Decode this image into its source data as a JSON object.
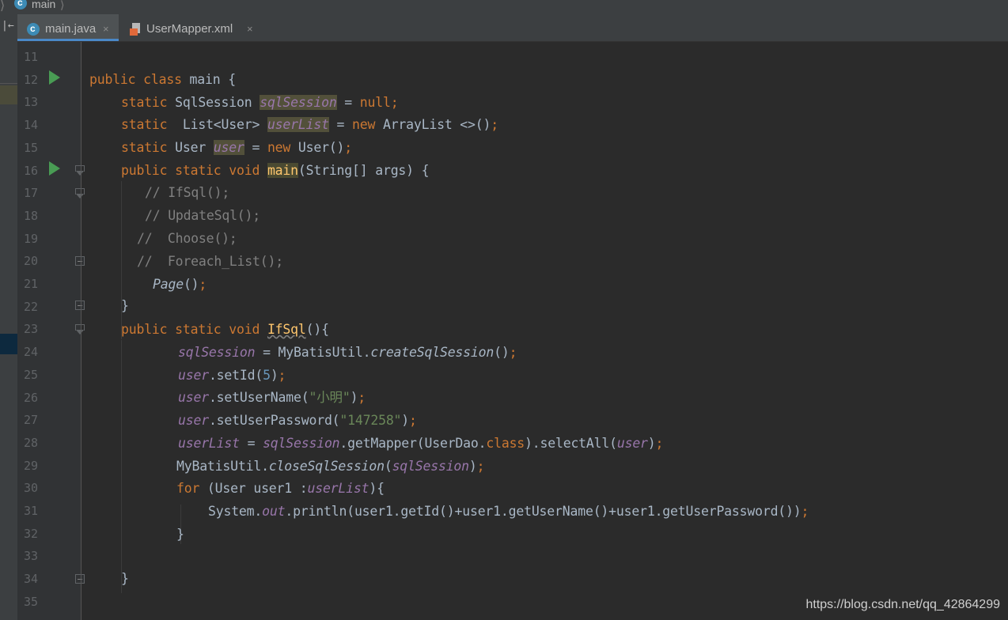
{
  "breadcrumb": {
    "item": "main"
  },
  "tabs": [
    {
      "label": "main.java",
      "active": true,
      "icon": "java-class-icon"
    },
    {
      "label": "UserMapper.xml",
      "active": false,
      "icon": "xml-file-icon"
    }
  ],
  "tab_close_glyph": "×",
  "gutter": {
    "line_numbers": [
      "11",
      "12",
      "13",
      "14",
      "15",
      "16",
      "17",
      "18",
      "19",
      "20",
      "21",
      "22",
      "23",
      "24",
      "25",
      "26",
      "27",
      "28",
      "29",
      "30",
      "31",
      "32",
      "33",
      "34",
      "35"
    ]
  },
  "code": {
    "l12": {
      "kw": "public class",
      "rest": " main {"
    },
    "l13": {
      "kw": "static",
      "type": " SqlSession ",
      "field": "sqlSession",
      "eq": " = ",
      "val": "null;"
    },
    "l14": {
      "kw": "static",
      "type": "  List<User> ",
      "field": "userList",
      "eq": " = ",
      "new": "new",
      "rest": " ArrayList <>()",
      "semi": ";"
    },
    "l15": {
      "kw": "static",
      "type": " User ",
      "field": "user",
      "eq": " = ",
      "new": "new",
      "rest": " User()",
      "semi": ";"
    },
    "l16": {
      "kw": "public static void",
      "sp": " ",
      "method": "main",
      "rest": "(String[] args) {"
    },
    "l17": "// IfSql();",
    "l18": "// UpdateSql();",
    "l19": "//  Choose();",
    "l20": "//  Foreach_List();",
    "l21": {
      "call": "Page",
      "rest": "()",
      "semi": ";"
    },
    "l22": "}",
    "l23": {
      "kw": "public static void",
      "sp": " ",
      "method": "IfSql",
      "rest": "(){"
    },
    "l24": {
      "field": "sqlSession",
      "eq": " = MyBatisUtil.",
      "call": "createSqlSession",
      "rest": "()",
      "semi": ";"
    },
    "l25": {
      "field": "user",
      "rest1": ".setId(",
      "num": "5",
      "rest2": ")",
      "semi": ";"
    },
    "l26": {
      "field": "user",
      "rest1": ".setUserName(",
      "str": "\"小明\"",
      "rest2": ")",
      "semi": ";"
    },
    "l27": {
      "field": "user",
      "rest1": ".setUserPassword(",
      "str": "\"147258\"",
      "rest2": ")",
      "semi": ";"
    },
    "l28": {
      "field": "userList",
      "eq": " = ",
      "field2": "sqlSession",
      "rest1": ".getMapper(UserDao.",
      "cls": "class",
      "rest2": ").selectAll(",
      "field3": "user",
      "rest3": ")",
      "semi": ";"
    },
    "l29": {
      "pre": "MyBatisUtil.",
      "call": "closeSqlSession",
      "open": "(",
      "field": "sqlSession",
      "close": ")",
      "semi": ";"
    },
    "l30": {
      "kw": "for",
      "rest": " (User user1 :",
      "field": "userList",
      "close": "){"
    },
    "l31": {
      "pre": "System.",
      "field": "out",
      "rest": ".println(user1.getId()+user1.getUserName()+user1.getUserPassword())",
      "semi": ";"
    },
    "l32": "}",
    "l34": "}"
  },
  "watermark": "https://blog.csdn.net/qq_42864299",
  "colors": {
    "background": "#2b2b2b",
    "keyword": "#cc7832",
    "field": "#9876aa",
    "string": "#6a8759",
    "number": "#6897bb",
    "method": "#ffc66d",
    "comment": "#808080",
    "text": "#a9b7c6"
  }
}
